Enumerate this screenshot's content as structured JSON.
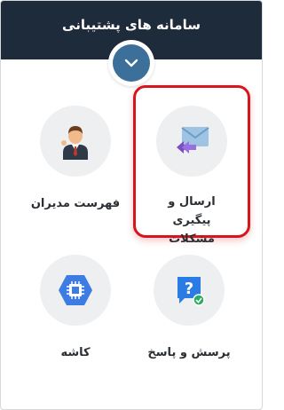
{
  "header": {
    "title": "سامانه های پشتیبانی"
  },
  "tiles": [
    {
      "label": "ارسال و پیگیری مشکلات",
      "icon": "envelope-reply-icon"
    },
    {
      "label": "فهرست مدیران",
      "icon": "manager-avatar-icon"
    },
    {
      "label": "پرسش و پاسخ",
      "icon": "question-chat-icon"
    },
    {
      "label": "کاشه",
      "icon": "chip-hexagon-icon"
    }
  ],
  "colors": {
    "header_bg": "#1e2b3b",
    "toggle_accent": "#3c6f99",
    "highlight": "#d8141c",
    "tile_circle": "#eeeff1"
  }
}
